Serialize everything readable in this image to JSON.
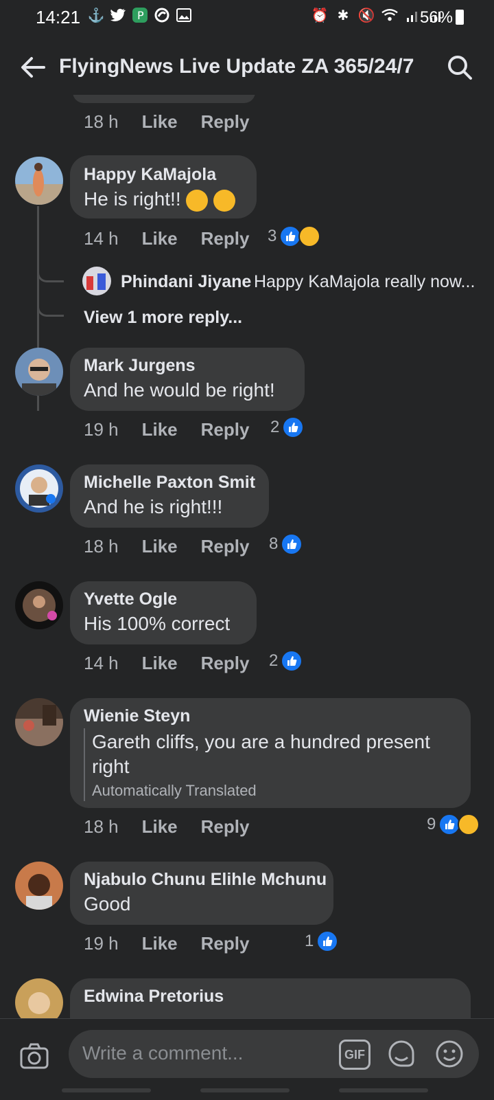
{
  "status_bar": {
    "time": "14:21",
    "battery": "56%"
  },
  "header": {
    "title": "FlyingNews Live Update ZA 365/24/7"
  },
  "top_meta": {
    "time": "18 h",
    "like": "Like",
    "reply": "Reply"
  },
  "comments": [
    {
      "author": "Happy KaMajola",
      "text": "He is right!!",
      "time": "14 h",
      "like": "Like",
      "reply": "Reply",
      "reactions": "3"
    },
    {
      "author": "Mark Jurgens",
      "text": "And he would be right!",
      "time": "19 h",
      "like": "Like",
      "reply": "Reply",
      "reactions": "2"
    },
    {
      "author": "Michelle Paxton Smit",
      "text": "And he is right!!!",
      "time": "18 h",
      "like": "Like",
      "reply": "Reply",
      "reactions": "8"
    },
    {
      "author": "Yvette Ogle",
      "text": "His 100% correct",
      "time": "14 h",
      "like": "Like",
      "reply": "Reply",
      "reactions": "2"
    },
    {
      "author": "Wienie Steyn",
      "text_line1": "Gareth cliffs, you are a hundred present",
      "text_line2": "right",
      "translated_label": "Automatically Translated",
      "time": "18 h",
      "like": "Like",
      "reply": "Reply",
      "reactions": "9"
    },
    {
      "author": "Njabulo Chunu Elihle Mchunu",
      "text": "Good",
      "time": "19 h",
      "like": "Like",
      "reply": "Reply",
      "reactions": "1"
    },
    {
      "author": "Edwina Pretorius"
    }
  ],
  "reply_preview": {
    "author": "Phindani Jiyane",
    "text": "Happy KaMajola really now..."
  },
  "view_more": "View 1 more reply...",
  "composer": {
    "placeholder": "Write a comment...",
    "gif_label": "GIF"
  },
  "colors": {
    "like_blue": "#1877f2",
    "care_yellow": "#f7b928"
  }
}
